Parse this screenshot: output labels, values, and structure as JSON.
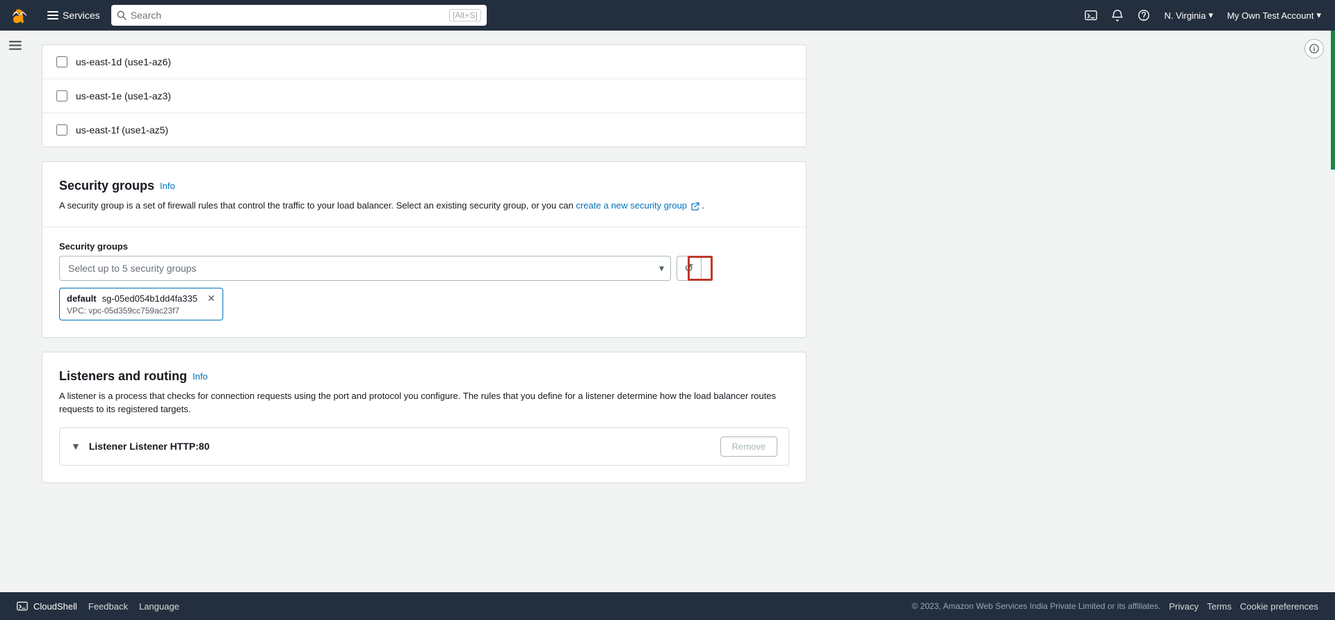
{
  "topnav": {
    "services_label": "Services",
    "search_placeholder": "Search",
    "search_shortcut": "[Alt+S]",
    "region": "N. Virginia",
    "account": "My Own Test Account"
  },
  "az_items": [
    {
      "id": "az-1d",
      "label": "us-east-1d (use1-az6)",
      "checked": false
    },
    {
      "id": "az-1e",
      "label": "us-east-1e (use1-az3)",
      "checked": false
    },
    {
      "id": "az-1f",
      "label": "us-east-1f (use1-az5)",
      "checked": false
    }
  ],
  "security_groups_section": {
    "title": "Security groups",
    "info_label": "Info",
    "description": "A security group is a set of firewall rules that control the traffic to your load balancer. Select an existing security group, or you can",
    "create_link_text": "create a new security group",
    "field_label": "Security groups",
    "select_placeholder": "Select up to 5 security groups",
    "selected_tag": {
      "name": "default",
      "id": "sg-05ed054b1dd4fa335",
      "vpc": "VPC: vpc-05d359cc759ac23f7"
    },
    "refresh_icon": "↺"
  },
  "listeners_section": {
    "title": "Listeners and routing",
    "info_label": "Info",
    "description": "A listener is a process that checks for connection requests using the port and protocol you configure. The rules that you define for a listener determine how the load balancer routes requests to its registered targets.",
    "listener_label": "Listener HTTP:80",
    "remove_button": "Remove"
  },
  "footer": {
    "cloudshell_label": "CloudShell",
    "feedback_label": "Feedback",
    "language_label": "Language",
    "copyright": "© 2023, Amazon Web Services India Private Limited or its affiliates.",
    "privacy_label": "Privacy",
    "terms_label": "Terms",
    "cookie_label": "Cookie preferences"
  }
}
